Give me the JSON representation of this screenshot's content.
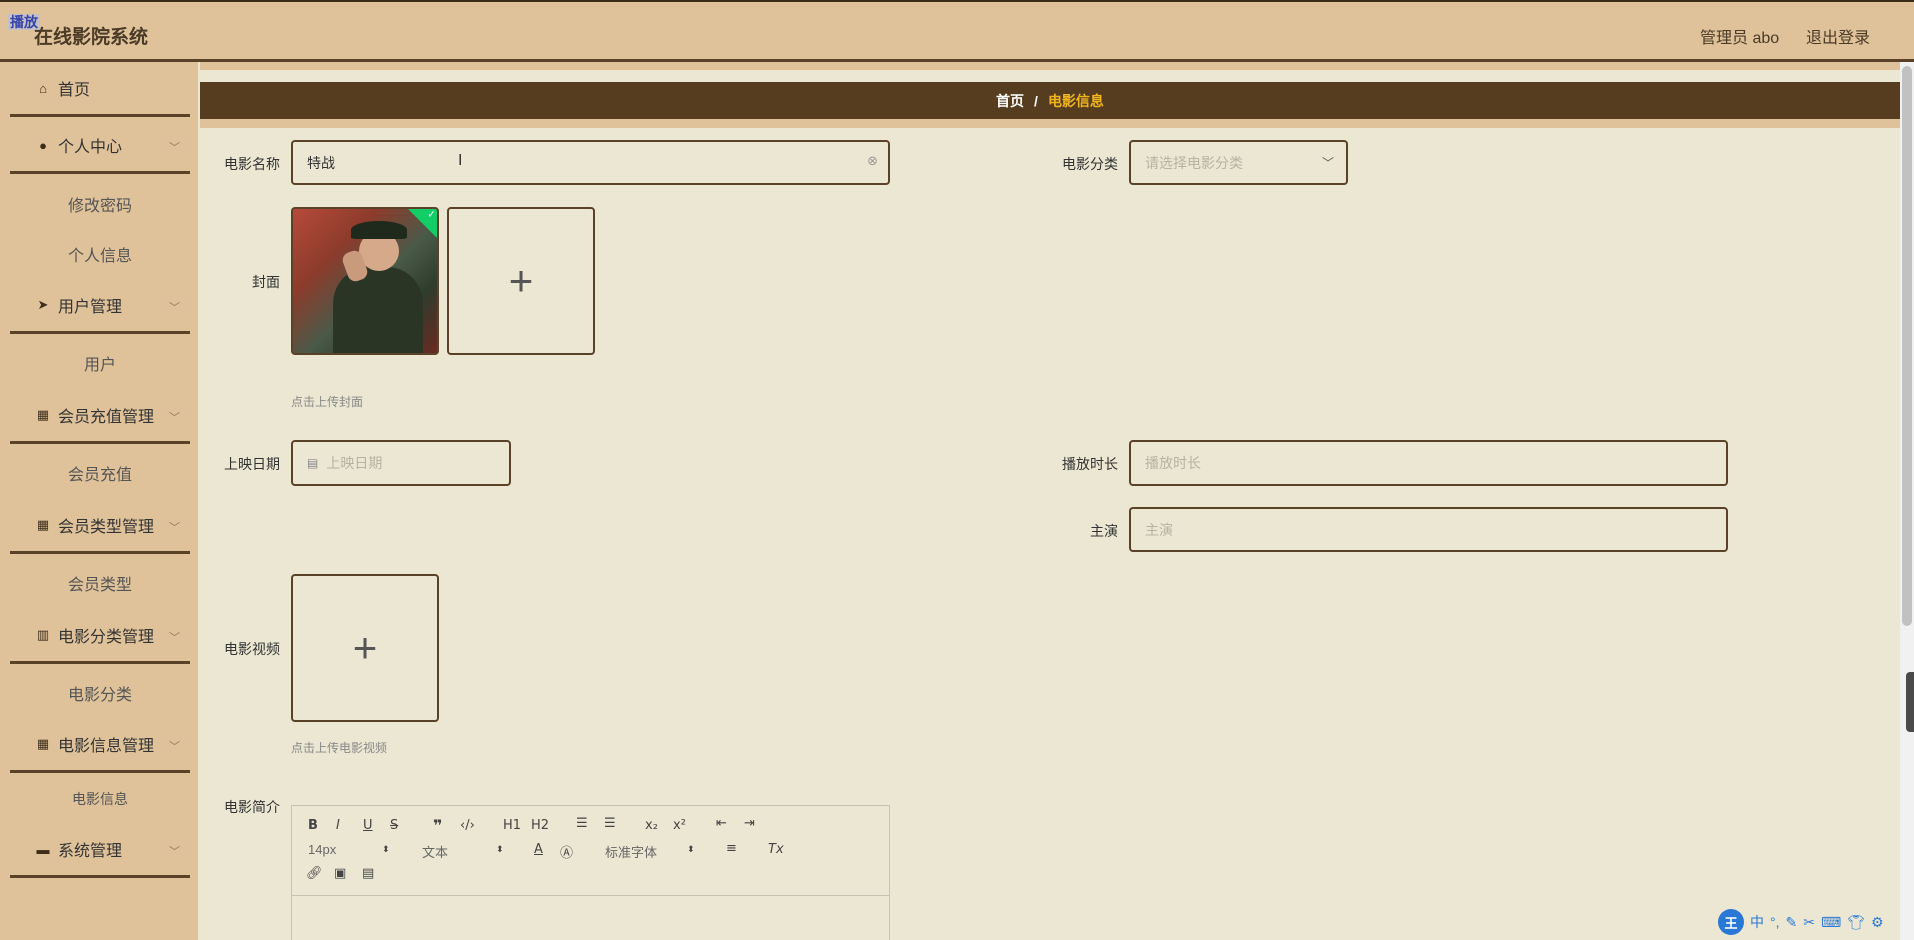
{
  "header": {
    "badge": "播放",
    "title": "在线影院系统",
    "user": "管理员 abo",
    "logout": "退出登录"
  },
  "sidebar": {
    "items": [
      {
        "label": "首页",
        "icon": "home-icon"
      },
      {
        "label": "个人中心",
        "icon": "user-icon"
      },
      {
        "label": "修改密码"
      },
      {
        "label": "个人信息"
      },
      {
        "label": "用户管理",
        "icon": "send-icon"
      },
      {
        "label": "用户"
      },
      {
        "label": "会员充值管理",
        "icon": "grid-icon"
      },
      {
        "label": "会员充值"
      },
      {
        "label": "会员类型管理",
        "icon": "grid-icon"
      },
      {
        "label": "会员类型"
      },
      {
        "label": "电影分类管理",
        "icon": "library-icon"
      },
      {
        "label": "电影分类"
      },
      {
        "label": "电影信息管理",
        "icon": "grid-icon"
      },
      {
        "label": "电影信息"
      },
      {
        "label": "系统管理",
        "icon": "monitor-icon"
      }
    ]
  },
  "breadcrumb": {
    "home": "首页",
    "separator": "/",
    "current": "电影信息"
  },
  "form": {
    "name_label": "电影名称",
    "name_value": "特战",
    "category_label": "电影分类",
    "category_placeholder": "请选择电影分类",
    "cover_label": "封面",
    "cover_hint": "点击上传封面",
    "release_label": "上映日期",
    "release_placeholder": "上映日期",
    "duration_label": "播放时长",
    "duration_placeholder": "播放时长",
    "actor_label": "主演",
    "actor_placeholder": "主演",
    "video_label": "电影视频",
    "video_hint": "点击上传电影视频",
    "intro_label": "电影简介"
  },
  "editor": {
    "font_size": "14px",
    "text_style": "文本",
    "font_family": "标准字体",
    "h1": "H1",
    "h2": "H2"
  },
  "ime": {
    "logo": "王",
    "mode": "中"
  },
  "colors": {
    "header_bg": "#dfc29a",
    "breadcrumb_bg": "#563d20",
    "accent": "#f0b51c",
    "page_bg": "#ebe7d2",
    "border": "#5a4228"
  }
}
